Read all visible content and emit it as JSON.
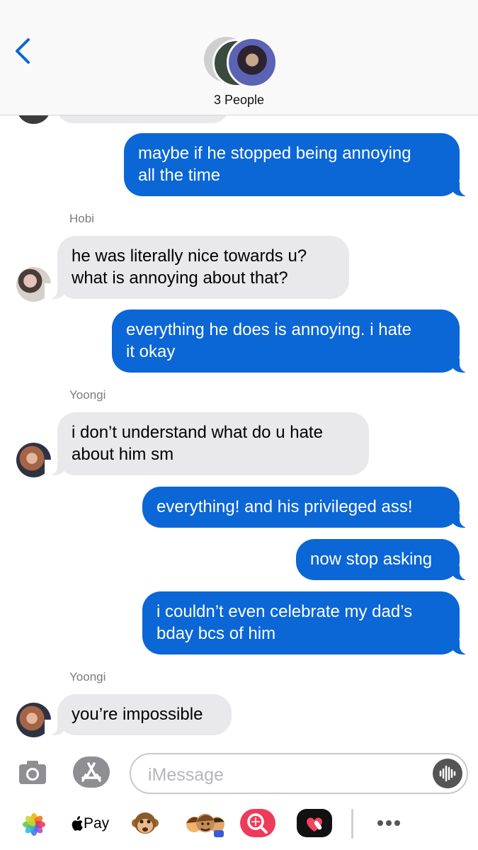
{
  "header": {
    "title": "3 People",
    "accent": "#0b66d6"
  },
  "messages": [
    {
      "type": "outgoing",
      "text": "maybe if he stopped being annoying\nall the time"
    },
    {
      "type": "sender",
      "text": "Hobi"
    },
    {
      "type": "incoming",
      "text": "he was literally nice towards u?\nwhat is annoying about that?"
    },
    {
      "type": "outgoing",
      "text": "everything he does is annoying. i hate\nit okay"
    },
    {
      "type": "sender",
      "text": "Yoongi"
    },
    {
      "type": "incoming",
      "text": "i don’t understand what do u hate\nabout him sm"
    },
    {
      "type": "outgoing",
      "text": "everything! and his privileged ass!"
    },
    {
      "type": "outgoing",
      "text": "now stop asking"
    },
    {
      "type": "outgoing",
      "text": "i couldn’t even celebrate my dad’s\nbday bcs of him"
    },
    {
      "type": "sender",
      "text": "Yoongi"
    },
    {
      "type": "incoming",
      "text": "you’re impossible"
    }
  ],
  "input": {
    "placeholder": "iMessage",
    "value": ""
  },
  "drawer": {
    "apple_pay_label": "Pay",
    "apps": [
      "photos-icon",
      "apple-pay-icon",
      "monkey-memoji-icon",
      "memoji-stickers-icon",
      "web-images-search-icon",
      "digital-touch-icon",
      "more-apps-icon"
    ]
  },
  "colors": {
    "outgoing_bubble": "#0b66d6",
    "incoming_bubble": "#e9e9eb"
  }
}
